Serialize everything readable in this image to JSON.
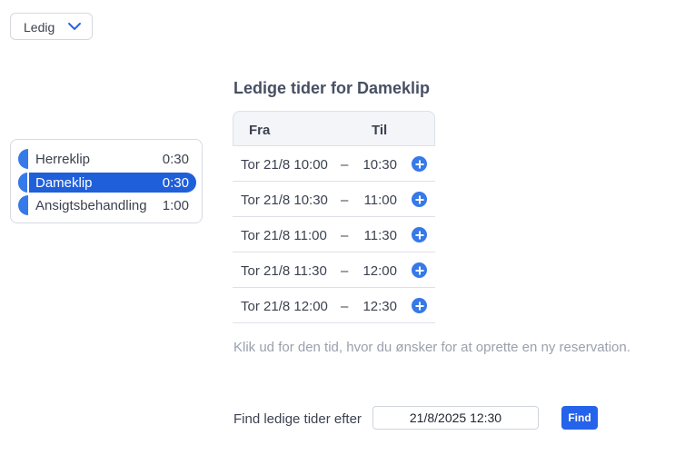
{
  "status_dropdown": {
    "label": "Ledig",
    "icon": "chevron-down-icon"
  },
  "services": [
    {
      "name": "Herreklip",
      "duration": "0:30",
      "selected": false
    },
    {
      "name": "Dameklip",
      "duration": "0:30",
      "selected": true
    },
    {
      "name": "Ansigtsbehandling",
      "duration": "1:00",
      "selected": false
    }
  ],
  "available": {
    "heading": "Ledige tider for Dameklip",
    "col_from": "Fra",
    "col_to": "Til",
    "separator": "–",
    "slots": [
      {
        "from": "Tor 21/8 10:00",
        "to": "10:30"
      },
      {
        "from": "Tor 21/8 10:30",
        "to": "11:00"
      },
      {
        "from": "Tor 21/8 11:00",
        "to": "11:30"
      },
      {
        "from": "Tor 21/8 11:30",
        "to": "12:00"
      },
      {
        "from": "Tor 21/8 12:00",
        "to": "12:30"
      }
    ],
    "hint": "Klik ud for den tid, hvor du ønsker for at oprette en ny reservation."
  },
  "find": {
    "label": "Find ledige tider efter",
    "datetime_value": "21/8/2025   12:30",
    "button_label": "Find"
  },
  "colors": {
    "accent": "#2563eb",
    "selected": "#1f5fd9",
    "knob": "#3679e8"
  }
}
